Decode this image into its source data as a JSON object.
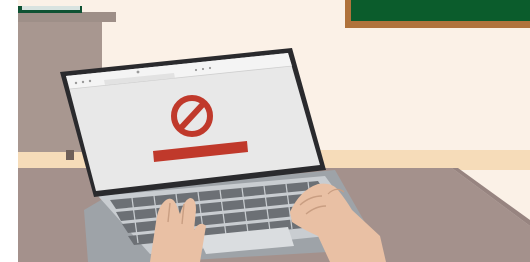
{
  "illustration": {
    "subject": "hands-typing-on-laptop-showing-blocked-page",
    "colors": {
      "wall": "#FBF1E7",
      "wall_stripe": "#F6DCB9",
      "desk": "#A4918C",
      "shelf": "#9E8F88",
      "chalkboard": "#0B5C2C",
      "chalkboard_frame": "#B0733C",
      "laptop_body": "#C9CDD1",
      "laptop_bezel": "#2A2A2D",
      "screen": "#E8E8E8",
      "keys": "#6C7075",
      "skin": "#E9C0A4",
      "block_icon": "#C0392B"
    },
    "icons": [
      "prohibited-icon",
      "browser-back-icon",
      "browser-forward-icon",
      "browser-refresh-icon"
    ]
  }
}
